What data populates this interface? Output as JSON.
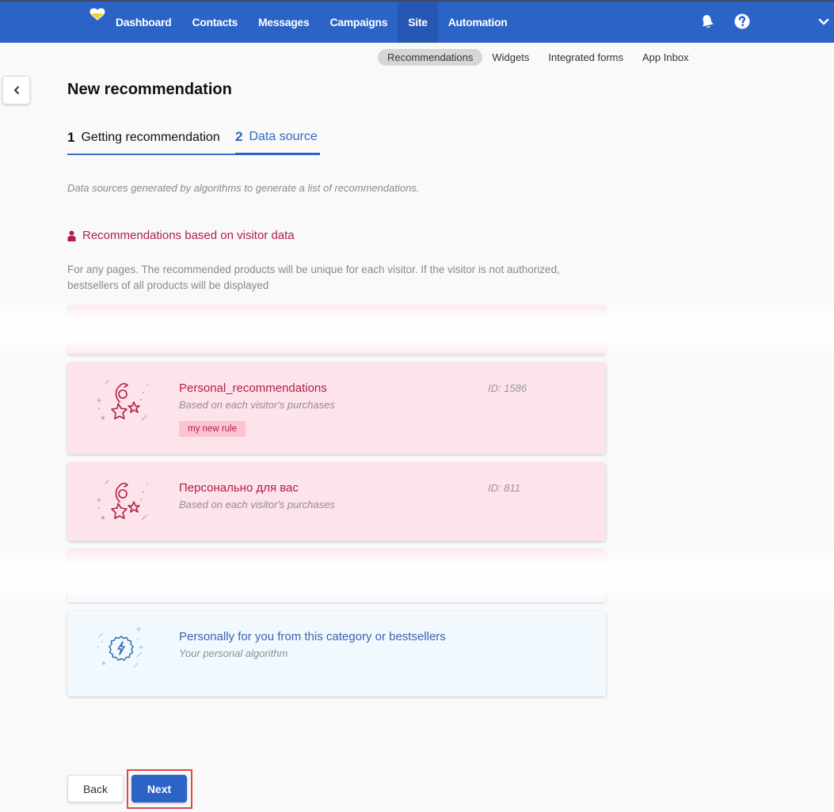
{
  "topbar": {
    "nav": [
      {
        "label": "Dashboard",
        "active": false
      },
      {
        "label": "Contacts",
        "active": false
      },
      {
        "label": "Messages",
        "active": false
      },
      {
        "label": "Campaigns",
        "active": false
      },
      {
        "label": "Site",
        "active": true
      },
      {
        "label": "Automation",
        "active": false
      }
    ],
    "icons": [
      "bell-icon",
      "help-icon",
      "chevron-down-icon"
    ],
    "colors": {
      "bar": "#2b63c6",
      "active": "#2557b3"
    }
  },
  "subnav": {
    "items": [
      {
        "label": "Recommendations",
        "active": true
      },
      {
        "label": "Widgets",
        "active": false
      },
      {
        "label": "Integrated forms",
        "active": false
      },
      {
        "label": "App Inbox",
        "active": false
      }
    ]
  },
  "page": {
    "title": "New recommendation",
    "steps": [
      {
        "num": "1",
        "label": "Getting recommendation"
      },
      {
        "num": "2",
        "label": "Data source"
      }
    ],
    "intro": "Data sources generated by algorithms to generate a list of recommendations."
  },
  "section": {
    "title": "Recommendations based on visitor data",
    "description": "For any pages. The recommended products will be unique for each visitor. If the visitor is not authorized, bestsellers of all products will be displayed"
  },
  "cards": [
    {
      "title": "Personal_recommendations",
      "subtitle": "Based on each visitor's purchases",
      "id": "ID: 1586",
      "tag": "my new rule"
    },
    {
      "title": "Персонально для вас",
      "subtitle": "Based on each visitor's purchases",
      "id": "ID: 811"
    },
    {
      "title": "Personally for you from this category or bestsellers",
      "subtitle": "Your personal algorithm"
    }
  ],
  "footer": {
    "back_label": "Back",
    "next_label": "Next"
  },
  "colors": {
    "accent": "#2b63c6",
    "section_red": "#b01e4a",
    "card_pink": "#fde3ea",
    "card_blue": "#f1f9fe",
    "highlight": "#e04848"
  }
}
